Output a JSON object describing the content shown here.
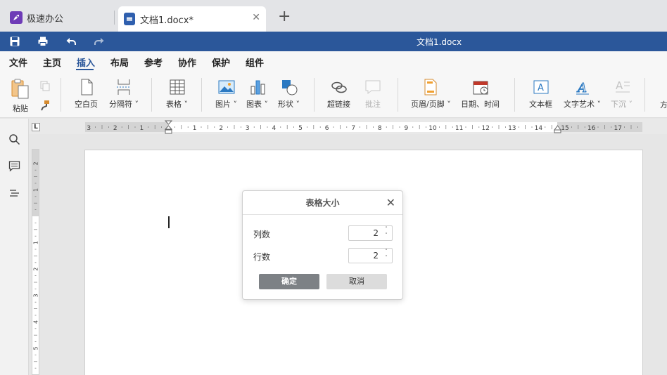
{
  "tabs": [
    {
      "label": "极速办公"
    },
    {
      "label": "文档1.docx*"
    }
  ],
  "window": {
    "title": "文档1.docx"
  },
  "menu": [
    "文件",
    "主页",
    "插入",
    "布局",
    "参考",
    "协作",
    "保护",
    "组件"
  ],
  "ribbon": {
    "paste": "粘贴",
    "blank_page": "空白页",
    "separator": "分隔符",
    "table": "表格",
    "picture": "图片",
    "chart": "图表",
    "shape": "形状",
    "hyperlink": "超链接",
    "comment": "批注",
    "header_footer": "页眉/页脚",
    "date_time": "日期、时间",
    "textbox": "文本框",
    "text_art": "文字艺术",
    "drop_cap": "下沉",
    "cut_off": "方"
  },
  "ruler": {
    "corner": "L"
  },
  "dialog": {
    "title": "表格大小",
    "columns_label": "列数",
    "columns_value": "2",
    "rows_label": "行数",
    "rows_value": "2",
    "ok": "确定",
    "cancel": "取消"
  },
  "colors": {
    "accent": "#2b579a",
    "tab_bar": "#e3e4e7"
  }
}
